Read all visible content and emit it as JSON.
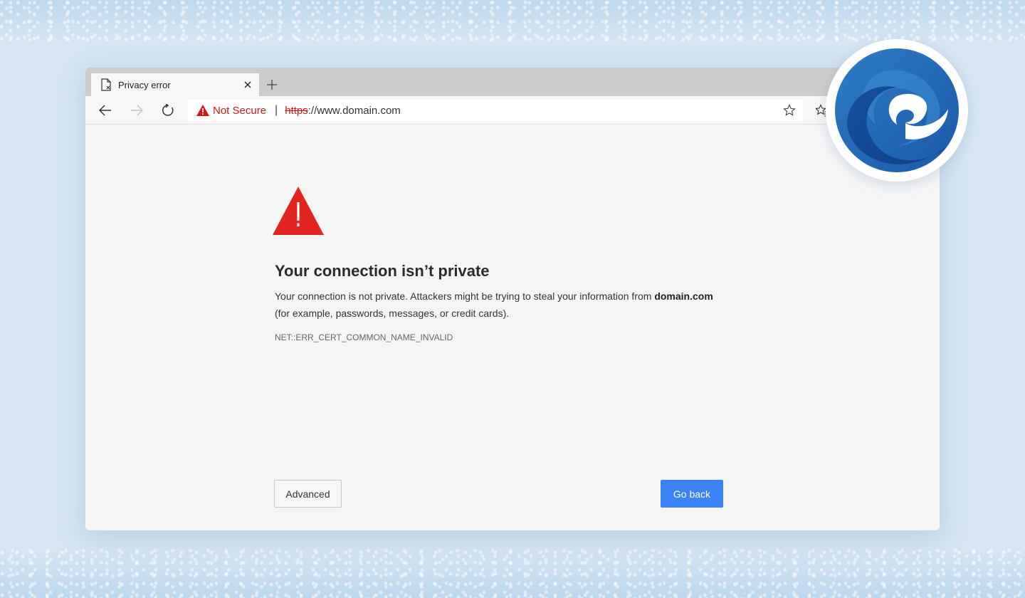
{
  "tab": {
    "title": "Privacy error",
    "icon": "page-error-icon"
  },
  "toolbar": {
    "back_icon": "arrow-left-icon",
    "forward_icon": "arrow-right-icon",
    "refresh_icon": "refresh-icon"
  },
  "address": {
    "security_label": "Not Secure",
    "separator": "|",
    "scheme": "https",
    "rest": "://www.domain.com",
    "security_color": "#d1191a"
  },
  "error": {
    "heading": "Your connection isn’t private",
    "description_prefix": "Your connection is not private. Attackers might be trying to steal your information from ",
    "domain": "domain.com",
    "description_suffix": "(for example, passwords, messages, or credit cards).",
    "code": "NET::ERR_CERT_COMMON_NAME_INVALID",
    "warning_color": "#e3251f"
  },
  "buttons": {
    "advanced": "Advanced",
    "go_back": "Go back",
    "go_back_color": "#3b82f6"
  },
  "brand": {
    "logo": "microsoft-edge-logo",
    "color": "#1a5fb4"
  }
}
